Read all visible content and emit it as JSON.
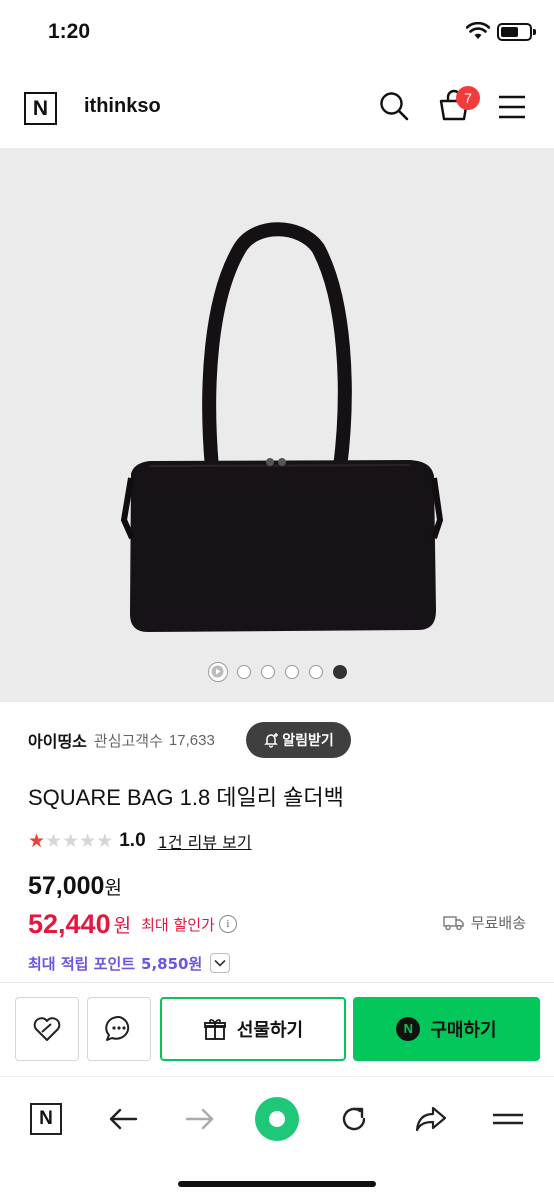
{
  "status_bar": {
    "time": "1:20"
  },
  "header": {
    "logo": "N",
    "shop_name": "ithinkso",
    "cart_count": "7"
  },
  "gallery": {
    "total_images": 5,
    "active_index": 5
  },
  "seller": {
    "name": "아이띵소",
    "interest_label": "관심고객수",
    "interest_count": "17,633",
    "alarm_label": "알림받기"
  },
  "product": {
    "title": "SQUARE BAG 1.8 데일리 숄더백",
    "rating": "1.0",
    "stars_filled": 1,
    "stars_total": 5,
    "review_link": "1건 리뷰 보기",
    "original_price": "57,000",
    "original_won": "원",
    "sale_price": "52,440",
    "sale_won": "원",
    "max_discount_label": "최대 할인가",
    "info_glyph": "i",
    "shipping_label": "무료배송",
    "points_label": "최대 적립 포인트",
    "points_value": "5,850원"
  },
  "actions": {
    "gift_label": "선물하기",
    "buy_label": "구매하기",
    "npay_glyph": "N"
  },
  "browser": {
    "logo": "N"
  },
  "colors": {
    "naver_green": "#03c75a",
    "sale_red": "#e3183c",
    "points_purple": "#6c56e0",
    "badge_red": "#f23b3b"
  }
}
